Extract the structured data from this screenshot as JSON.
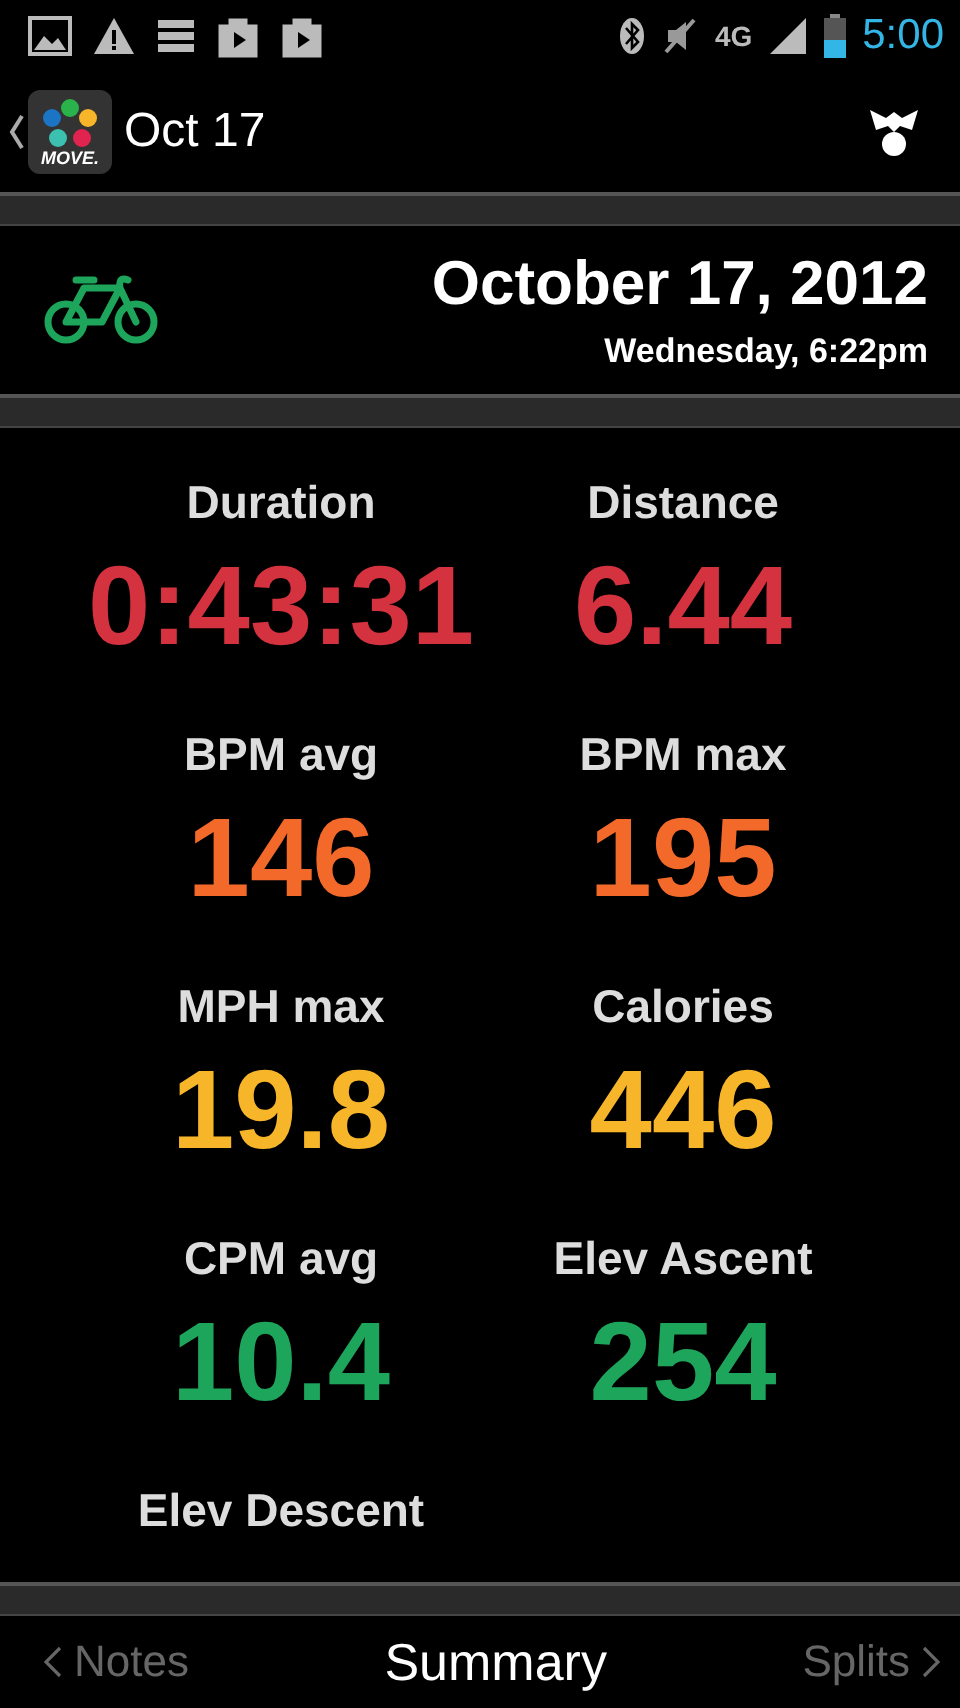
{
  "status_bar": {
    "network_label": "4G",
    "time": "5:00"
  },
  "action_bar": {
    "logo_text": "MOVE.",
    "title": "Oct 17"
  },
  "header": {
    "date": "October 17, 2012",
    "subtitle": "Wednesday, 6:22pm"
  },
  "stats": [
    {
      "label": "Duration",
      "value": "0:43:31",
      "color": "#d4323e"
    },
    {
      "label": "Distance",
      "value": "6.44",
      "color": "#d4323e"
    },
    {
      "label": "BPM avg",
      "value": "146",
      "color": "#f2692a"
    },
    {
      "label": "BPM max",
      "value": "195",
      "color": "#f2692a"
    },
    {
      "label": "MPH max",
      "value": "19.8",
      "color": "#f7b52a"
    },
    {
      "label": "Calories",
      "value": "446",
      "color": "#f7b52a"
    },
    {
      "label": "CPM avg",
      "value": "10.4",
      "color": "#1ea55c"
    },
    {
      "label": "Elev Ascent",
      "value": "254",
      "color": "#1ea55c"
    },
    {
      "label": "Elev Descent"
    }
  ],
  "tabs": [
    {
      "label": "Notes",
      "selected": false,
      "kind": "prev"
    },
    {
      "label": "Summary",
      "selected": true,
      "kind": "current"
    },
    {
      "label": "Splits",
      "selected": false,
      "kind": "next"
    }
  ]
}
